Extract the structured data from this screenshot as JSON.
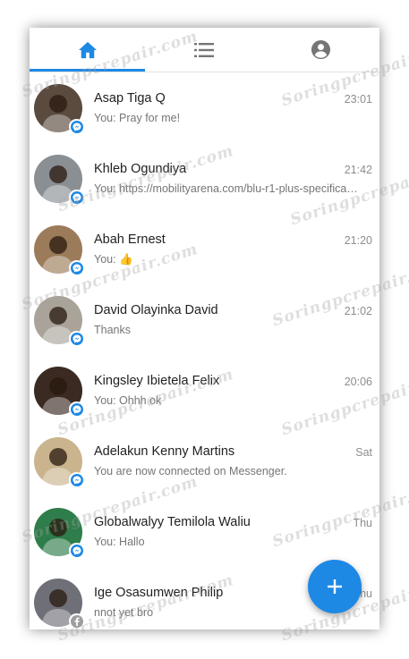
{
  "app": {
    "tabs": [
      {
        "id": "home",
        "icon": "home-icon",
        "active": true
      },
      {
        "id": "list",
        "icon": "list-icon",
        "active": false
      },
      {
        "id": "profile",
        "icon": "account-circle-icon",
        "active": false
      }
    ],
    "accent_color": "#1e88e5"
  },
  "conversations": [
    {
      "name": "Asap Tiga Q",
      "time": "23:01",
      "preview": "You: Pray for me!",
      "badge": "messenger-icon",
      "avatar_color": "#5b4a3e"
    },
    {
      "name": "Khleb Ogundiya",
      "time": "21:42",
      "preview": "You: https://mobilityarena.com/blu-r1-plus-specifica…",
      "badge": "messenger-icon",
      "avatar_color": "#8a8f94"
    },
    {
      "name": "Abah Ernest",
      "time": "21:20",
      "preview": "You: 👍",
      "badge": "messenger-icon",
      "avatar_color": "#9c7b5a"
    },
    {
      "name": "David Olayinka David",
      "time": "21:02",
      "preview": "Thanks",
      "badge": "messenger-icon",
      "avatar_color": "#a9a39a"
    },
    {
      "name": "Kingsley Ibietela Felix",
      "time": "20:06",
      "preview": "You: Ohhh ok",
      "badge": "messenger-icon",
      "avatar_color": "#3b2a22"
    },
    {
      "name": "Adelakun Kenny Martins",
      "time": "Sat",
      "preview": "You are now connected on Messenger.",
      "badge": "messenger-icon",
      "avatar_color": "#c9b48e"
    },
    {
      "name": "Globalwalyy Temilola Waliu",
      "time": "Thu",
      "preview": "You: Hallo",
      "badge": "messenger-icon",
      "avatar_color": "#2e7d4a"
    },
    {
      "name": "Ige Osasumwen Philip",
      "time": "Thu",
      "preview": "nnot yet bro",
      "badge": "facebook-icon",
      "avatar_color": "#6f6f78"
    }
  ],
  "fab": {
    "icon": "plus-icon"
  },
  "watermark": {
    "text": "Soringpcrepair.com"
  }
}
